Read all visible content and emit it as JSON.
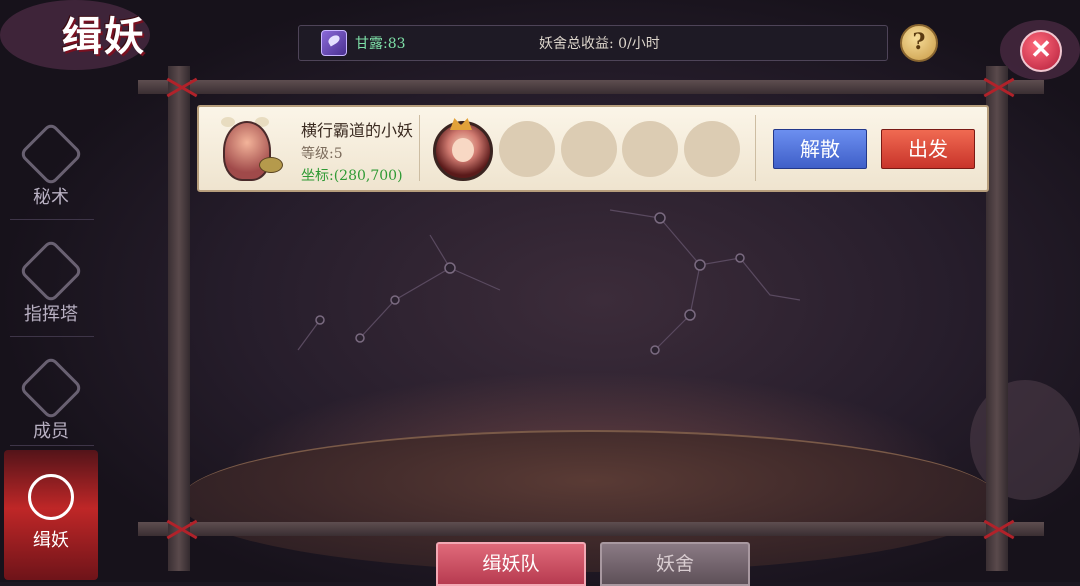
{
  "title": "缉妖",
  "topbar": {
    "nectar_icon": "nectar-gem-icon",
    "nectar_label": "甘露:83",
    "income_label": "妖舍总收益: 0/小时"
  },
  "help_button": "?",
  "close_button": "✕",
  "sidebar": {
    "items": [
      {
        "label": "秘术",
        "icon": "mystic-arts-icon",
        "active": false
      },
      {
        "label": "指挥塔",
        "icon": "command-tower-icon",
        "active": false
      },
      {
        "label": "成员",
        "icon": "members-shield-icon",
        "active": false
      },
      {
        "label": "缉妖",
        "icon": "demon-hunt-icon",
        "active": true
      }
    ]
  },
  "team": {
    "name": "横行霸道的小妖",
    "level": "等级:5",
    "coords": "坐标:(280,700)",
    "slots_filled": 1,
    "slots_total": 5,
    "disband_label": "解散",
    "depart_label": "出发"
  },
  "tabs": [
    {
      "label": "缉妖队",
      "active": true
    },
    {
      "label": "妖舍",
      "active": false
    }
  ],
  "colors": {
    "accent_red": "#c8342a",
    "accent_blue": "#3f5fc8",
    "coord_green": "#2f9a34",
    "nectar_green": "#7ee0a8"
  }
}
